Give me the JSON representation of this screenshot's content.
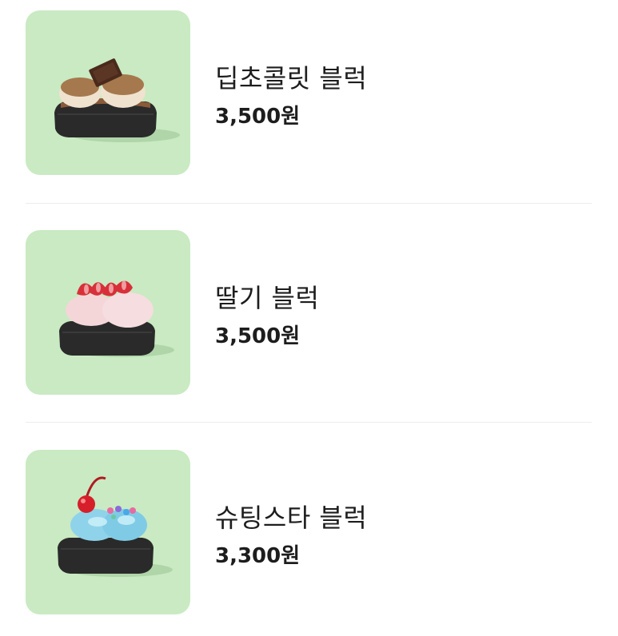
{
  "menu": {
    "items": [
      {
        "name": "딥초콜릿 블럭",
        "price": "3,500원",
        "image": "deep-chocolate-block-photo"
      },
      {
        "name": "딸기 블럭",
        "price": "3,500원",
        "image": "strawberry-block-photo"
      },
      {
        "name": "슈팅스타 블럭",
        "price": "3,300원",
        "image": "shooting-star-block-photo"
      }
    ]
  },
  "colors": {
    "thumb_background": "#c9eac2",
    "text": "#1d1d1d",
    "divider": "#ececec",
    "charcoal_bread": "#2a2a2a"
  }
}
